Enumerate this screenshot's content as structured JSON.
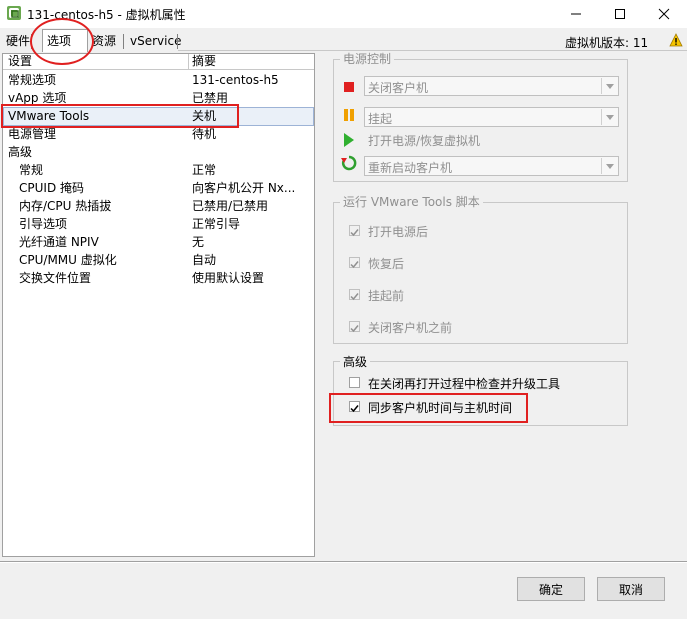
{
  "window": {
    "title": "131-centos-h5 - 虚拟机属性",
    "icons": {
      "app": "vm-properties-icon",
      "minimize": "minimize-icon",
      "maximize": "maximize-icon",
      "close": "close-icon"
    }
  },
  "tabs": [
    {
      "label": "硬件"
    },
    {
      "label": "选项",
      "selected": true
    },
    {
      "label": "资源"
    },
    {
      "label": "vService"
    }
  ],
  "version_text": "虚拟机版本: 11",
  "list": {
    "headers": [
      "设置",
      "摘要"
    ],
    "rows": [
      {
        "setting": "常规选项",
        "summary": "131-centos-h5",
        "indent": 0
      },
      {
        "setting": "vApp 选项",
        "summary": "已禁用",
        "indent": 0
      },
      {
        "setting": "VMware Tools",
        "summary": "关机",
        "indent": 0,
        "selected": true
      },
      {
        "setting": "电源管理",
        "summary": "待机",
        "indent": 0
      },
      {
        "setting": "高级",
        "summary": "",
        "indent": 0
      },
      {
        "setting": "常规",
        "summary": "正常",
        "indent": 1
      },
      {
        "setting": "CPUID 掩码",
        "summary": "向客户机公开 Nx...",
        "indent": 1
      },
      {
        "setting": "内存/CPU 热插拔",
        "summary": "已禁用/已禁用",
        "indent": 1
      },
      {
        "setting": "引导选项",
        "summary": "正常引导",
        "indent": 1
      },
      {
        "setting": "光纤通道 NPIV",
        "summary": "无",
        "indent": 1
      },
      {
        "setting": "CPU/MMU 虚拟化",
        "summary": "自动",
        "indent": 1
      },
      {
        "setting": "交换文件位置",
        "summary": "使用默认设置",
        "indent": 1
      }
    ]
  },
  "power_controls": {
    "title": "电源控制",
    "items": [
      {
        "icon": "stop-icon",
        "value": "关闭客户机",
        "type": "dropdown"
      },
      {
        "icon": "pause-icon",
        "value": "挂起",
        "type": "dropdown"
      },
      {
        "icon": "play-icon",
        "value": "打开电源/恢复虚拟机",
        "type": "label"
      },
      {
        "icon": "restart-icon",
        "value": "重新启动客户机",
        "type": "dropdown"
      }
    ]
  },
  "scripts": {
    "title": "运行 VMware Tools 脚本",
    "items": [
      {
        "label": "打开电源后",
        "checked": true
      },
      {
        "label": "恢复后",
        "checked": true
      },
      {
        "label": "挂起前",
        "checked": true
      },
      {
        "label": "关闭客户机之前",
        "checked": true
      }
    ]
  },
  "advanced": {
    "title": "高级",
    "items": [
      {
        "label": "在关闭再打开过程中检查并升级工具",
        "checked": false
      },
      {
        "label": "同步客户机时间与主机时间",
        "checked": true
      }
    ]
  },
  "buttons": {
    "ok": "确定",
    "cancel": "取消"
  },
  "colors": {
    "annotation": "#e02020",
    "stop": "#e02020",
    "pause": "#f0a000",
    "play": "#30b030"
  }
}
